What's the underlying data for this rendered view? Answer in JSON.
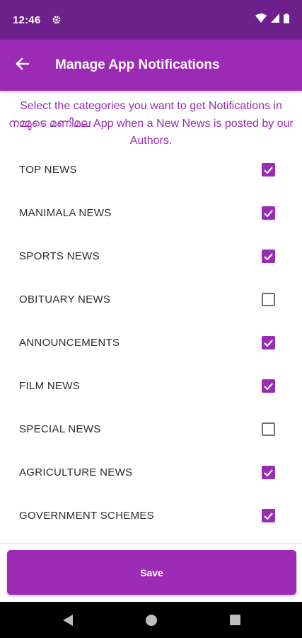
{
  "status_bar": {
    "time": "12:46",
    "icons": [
      "gear-icon",
      "wifi-icon",
      "signal-icon",
      "battery-icon"
    ]
  },
  "header": {
    "title": "Manage App Notifications",
    "back_icon": "arrow-left-icon"
  },
  "intro_text": "Select the categories you want to get Notifications in നമ്മുടെ മണിമല App when a New News is posted by our Authors.",
  "categories": [
    {
      "label": "TOP NEWS",
      "checked": true
    },
    {
      "label": "MANIMALA NEWS",
      "checked": true
    },
    {
      "label": "SPORTS NEWS",
      "checked": true
    },
    {
      "label": "OBITUARY NEWS",
      "checked": false
    },
    {
      "label": "ANNOUNCEMENTS",
      "checked": true
    },
    {
      "label": "FILM NEWS",
      "checked": true
    },
    {
      "label": "SPECIAL NEWS",
      "checked": false
    },
    {
      "label": "AGRICULTURE NEWS",
      "checked": true
    },
    {
      "label": "GOVERNMENT SCHEMES",
      "checked": true
    }
  ],
  "save_label": "Save",
  "colors": {
    "status_bar": "#6d1f8c",
    "primary": "#9b2bb5",
    "nav_bar": "#000000"
  },
  "nav_icons": [
    "back-triangle-icon",
    "home-circle-icon",
    "recents-square-icon"
  ]
}
